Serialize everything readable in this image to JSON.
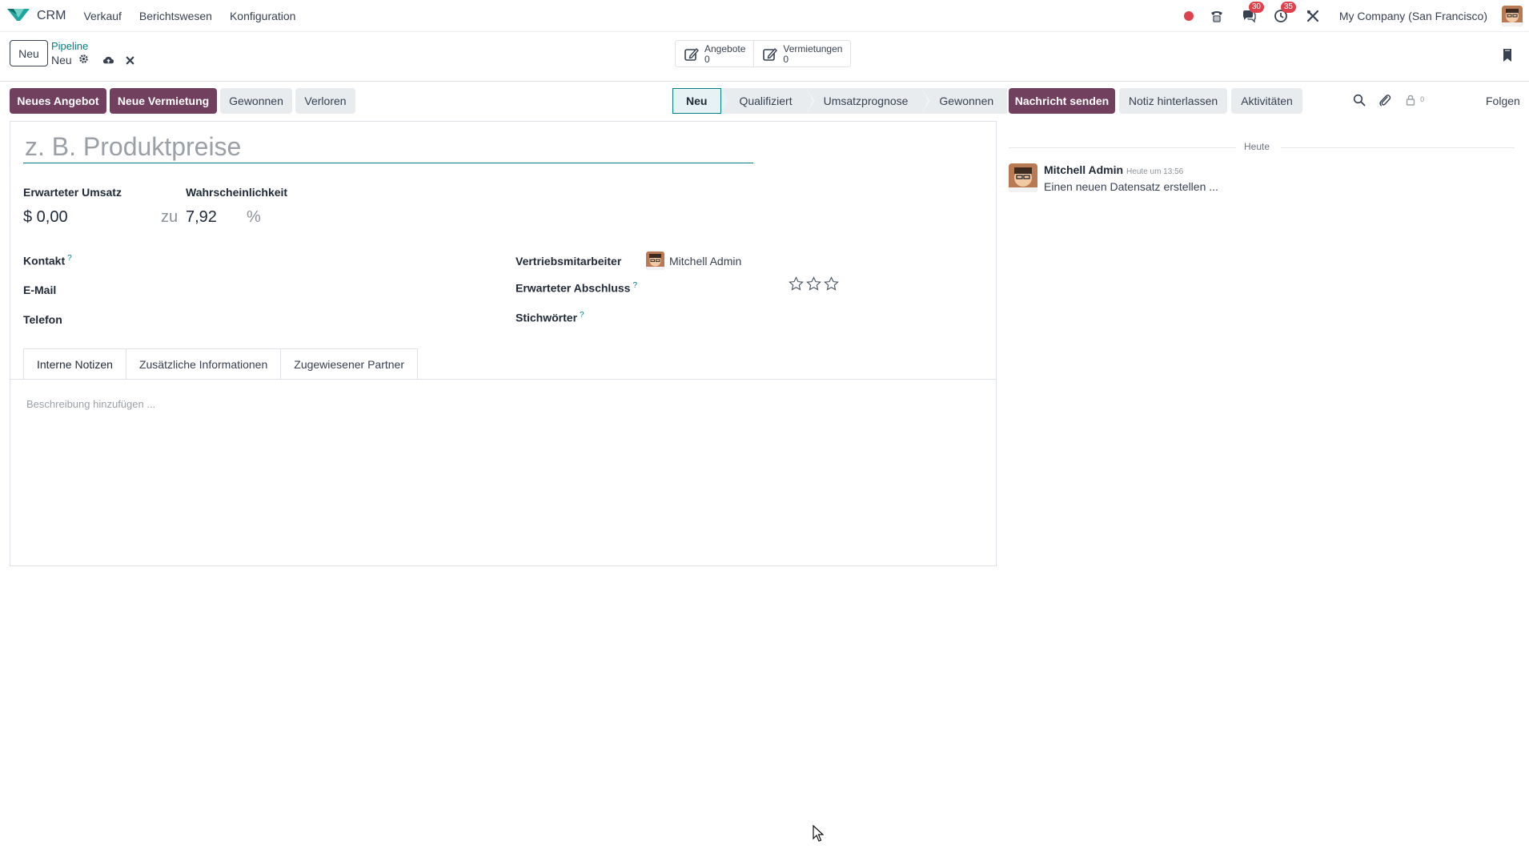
{
  "navbar": {
    "app_name": "CRM",
    "menu": [
      "Verkauf",
      "Berichtswesen",
      "Konfiguration"
    ],
    "messages_badge": "30",
    "activities_badge": "35",
    "company": "My Company (San Francisco)"
  },
  "control": {
    "new_label": "Neu",
    "breadcrumb": "Pipeline",
    "record_name": "Neu",
    "smart_buttons": [
      {
        "label": "Angebote",
        "count": "0"
      },
      {
        "label": "Vermietungen",
        "count": "0"
      }
    ]
  },
  "actions": {
    "new_quote": "Neues Angebot",
    "new_rental": "Neue Vermietung",
    "won": "Gewonnen",
    "lost": "Verloren"
  },
  "stages": [
    "Neu",
    "Qualifiziert",
    "Umsatzprognose",
    "Gewonnen"
  ],
  "form": {
    "title_placeholder": "z. B. Produktpreise",
    "expected_revenue_label": "Erwarteter Umsatz",
    "expected_revenue_value": "$ 0,00",
    "probability_label": "Wahrscheinlichkeit",
    "at_label": "zu",
    "probability_value": "7,92",
    "percent": "%",
    "contact_label": "Kontakt",
    "email_label": "E-Mail",
    "phone_label": "Telefon",
    "salesperson_label": "Vertriebsmitarbeiter",
    "salesperson_value": "Mitchell Admin",
    "expected_closing_label": "Erwarteter Abschluss",
    "tags_label": "Stichwörter",
    "help": "?",
    "priority_stars": 0,
    "tabs": [
      "Interne Notizen",
      "Zusätzliche Informationen",
      "Zugewiesener Partner"
    ],
    "description_placeholder": "Beschreibung hinzufügen ..."
  },
  "chatter": {
    "send_message": "Nachricht senden",
    "log_note": "Notiz hinterlassen",
    "activities": "Aktivitäten",
    "follower_count": "0",
    "follow": "Folgen",
    "today": "Heute",
    "message": {
      "author": "Mitchell Admin",
      "time": "Heute um 13:56",
      "body": "Einen neuen Datensatz erstellen ..."
    }
  },
  "colors": {
    "primary": "#71405e",
    "accent": "#017e84",
    "badge": "#e0424b"
  }
}
